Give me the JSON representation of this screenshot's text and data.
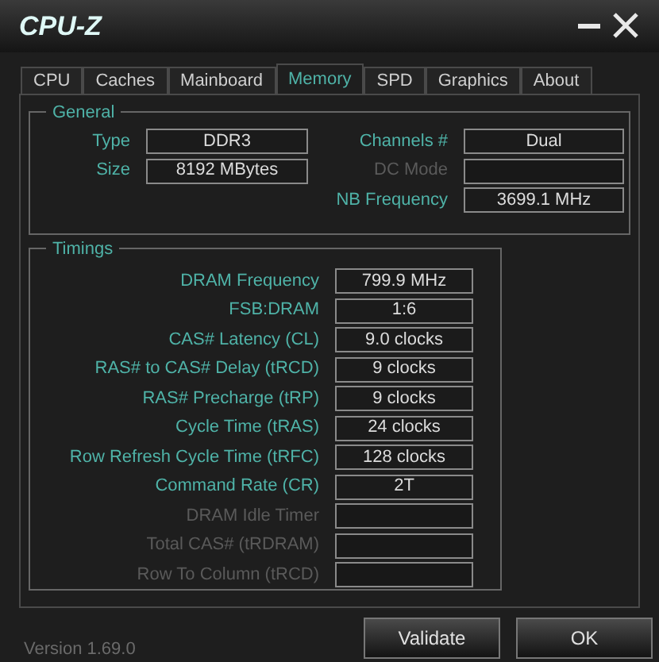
{
  "window": {
    "title": "CPU-Z"
  },
  "tabs": [
    {
      "label": "CPU",
      "selected": false
    },
    {
      "label": "Caches",
      "selected": false
    },
    {
      "label": "Mainboard",
      "selected": false
    },
    {
      "label": "Memory",
      "selected": true
    },
    {
      "label": "SPD",
      "selected": false
    },
    {
      "label": "Graphics",
      "selected": false
    },
    {
      "label": "About",
      "selected": false
    }
  ],
  "general": {
    "title": "General",
    "left": [
      {
        "label": "Type",
        "value": "DDR3",
        "disabled": false
      },
      {
        "label": "Size",
        "value": "8192 MBytes",
        "disabled": false
      }
    ],
    "right": [
      {
        "label": "Channels #",
        "value": "Dual",
        "disabled": false
      },
      {
        "label": "DC Mode",
        "disabled": true
      },
      {
        "label": "NB Frequency",
        "value": "3699.1 MHz",
        "disabled": false
      }
    ]
  },
  "timings": {
    "title": "Timings",
    "rows": [
      {
        "label": "DRAM Frequency",
        "value": "799.9 MHz",
        "disabled": false
      },
      {
        "label": "FSB:DRAM",
        "value": "1:6",
        "disabled": false
      },
      {
        "label": "CAS# Latency (CL)",
        "value": "9.0 clocks",
        "disabled": false
      },
      {
        "label": "RAS# to CAS# Delay (tRCD)",
        "value": "9 clocks",
        "disabled": false
      },
      {
        "label": "RAS# Precharge (tRP)",
        "value": "9 clocks",
        "disabled": false
      },
      {
        "label": "Cycle Time (tRAS)",
        "value": "24 clocks",
        "disabled": false
      },
      {
        "label": "Row Refresh Cycle Time (tRFC)",
        "value": "128 clocks",
        "disabled": false
      },
      {
        "label": "Command Rate (CR)",
        "value": "2T",
        "disabled": false
      },
      {
        "label": "DRAM Idle Timer",
        "disabled": true
      },
      {
        "label": "Total CAS# (tRDRAM)",
        "disabled": true
      },
      {
        "label": "Row To Column (tRCD)",
        "disabled": true
      }
    ]
  },
  "footer": {
    "version": "Version 1.69.0",
    "buttons": [
      "Validate",
      "OK"
    ]
  }
}
